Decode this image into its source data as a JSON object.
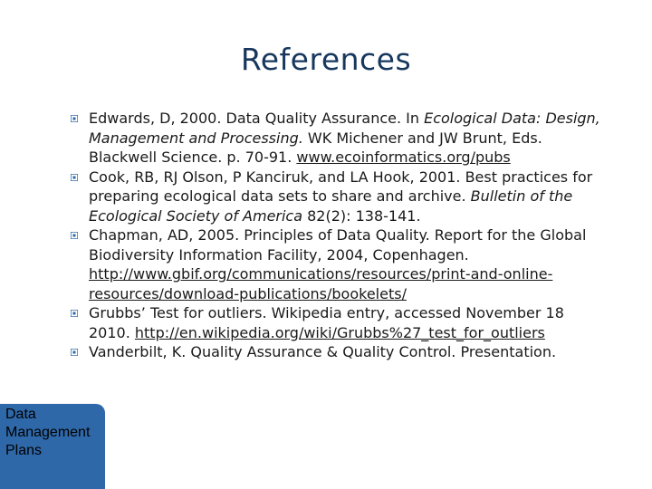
{
  "title": "References",
  "references": [
    {
      "parts": [
        {
          "t": "text",
          "v": "Edwards, D, 2000. Data Quality Assurance. In "
        },
        {
          "t": "italic",
          "v": "Ecological Data: Design, Management and Processing."
        },
        {
          "t": "text",
          "v": " WK Michener and JW Brunt, Eds. Blackwell Science. p. 70-91. "
        },
        {
          "t": "link",
          "v": "www.ecoinformatics.org/pubs"
        }
      ]
    },
    {
      "parts": [
        {
          "t": "text",
          "v": "Cook, RB, RJ Olson, P Kanciruk, and LA Hook, 2001. Best practices for preparing ecological data sets to share and archive. "
        },
        {
          "t": "italic",
          "v": "Bulletin of the Ecological Society of America"
        },
        {
          "t": "text",
          "v": " 82(2): 138-141."
        }
      ]
    },
    {
      "parts": [
        {
          "t": "text",
          "v": "Chapman, AD, 2005. Principles of Data Quality. Report for the Global Biodiversity Information Facility, 2004, Copenhagen. "
        },
        {
          "t": "link",
          "v": "http://www.gbif.org/communications/resources/print-and-online-resources/download-publications/bookelets/"
        }
      ]
    },
    {
      "parts": [
        {
          "t": "text",
          "v": "Grubbs’ Test for outliers. Wikipedia entry, accessed November 18 2010. "
        },
        {
          "t": "link",
          "v": "http://en.wikipedia.org/wiki/Grubbs%27_test_for_outliers"
        }
      ]
    },
    {
      "parts": [
        {
          "t": "text",
          "v": "Vanderbilt, K. Quality Assurance & Quality Control. Presentation."
        }
      ]
    }
  ],
  "badge": {
    "lines": [
      "Data",
      "Management",
      "Plans"
    ]
  },
  "colors": {
    "title": "#17375e",
    "badge": "#2f68a8",
    "bullet": "#2f68a8"
  },
  "icons": {
    "bullet": "square-bullet-icon"
  }
}
